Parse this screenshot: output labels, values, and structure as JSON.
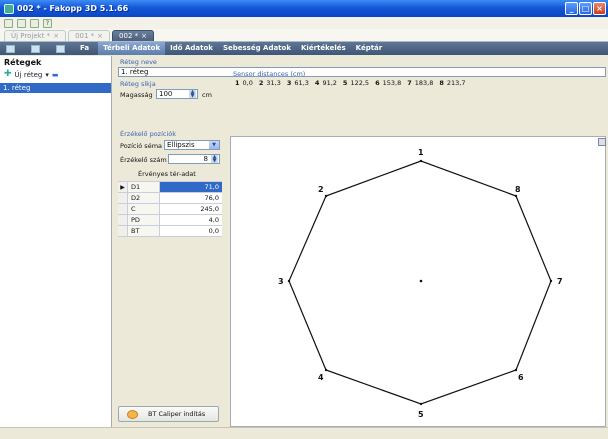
{
  "window": {
    "title": "002 * - Fakopp 3D 5.1.66"
  },
  "doc_tabs": [
    {
      "label": "Új Projekt *",
      "close": "×"
    },
    {
      "label": "001 *",
      "close": "×"
    },
    {
      "label": "002 *",
      "close": "×"
    }
  ],
  "ribbon": {
    "fa_label": "Fa",
    "tabs": [
      "Térbeli Adatok",
      "Idő Adatok",
      "Sebesség Adatok",
      "Kiértékelés",
      "Képtár"
    ],
    "active_tab": "Térbeli Adatok"
  },
  "left_panel": {
    "title": "Rétegek",
    "new_layer": "Új réteg",
    "new_layer_dropdown": "▾",
    "items": [
      "1. réteg"
    ]
  },
  "layer_name": {
    "label": "Réteg neve",
    "value": "1. réteg"
  },
  "layer_plane": {
    "label": "Réteg síkja",
    "height_label": "Magasság",
    "height_value": "100",
    "unit": "cm"
  },
  "sensor_distances": {
    "label": "Sensor distances (cm)",
    "items": [
      {
        "n": "1",
        "v": "0,0"
      },
      {
        "n": "2",
        "v": "31,3"
      },
      {
        "n": "3",
        "v": "61,3"
      },
      {
        "n": "4",
        "v": "91,2"
      },
      {
        "n": "5",
        "v": "122,5"
      },
      {
        "n": "6",
        "v": "153,8"
      },
      {
        "n": "7",
        "v": "183,8"
      },
      {
        "n": "8",
        "v": "213,7"
      }
    ]
  },
  "sensor_positions": {
    "label": "Érzékelő pozíciók",
    "scheme_label": "Pozíció séma",
    "scheme_value": "Ellipszis",
    "count_label": "Érzékelő szám",
    "count_value": "8",
    "valid_label": "Érvényes tér-adat"
  },
  "param_table": [
    {
      "name": "D1",
      "value": "71,0",
      "selected": true
    },
    {
      "name": "D2",
      "value": "76,0",
      "selected": false
    },
    {
      "name": "C",
      "value": "245,0",
      "selected": false
    },
    {
      "name": "PD",
      "value": "4,0",
      "selected": false
    },
    {
      "name": "BT",
      "value": "0,0",
      "selected": false
    }
  ],
  "bt_button": {
    "label": "BT Caliper indítás"
  },
  "canvas": {
    "sensor_labels": [
      "1",
      "2",
      "3",
      "4",
      "5",
      "6",
      "7",
      "8"
    ]
  },
  "icons": {
    "app": "tree-app-icon",
    "new": "new-file-icon",
    "save": "save-icon",
    "help": "help-icon",
    "caliper": "caliper-icon",
    "export": "export-icon"
  },
  "colors": {
    "selection": "#3169c6",
    "ribbon": "#4c5f7c",
    "label_blue": "#3b63b0"
  }
}
